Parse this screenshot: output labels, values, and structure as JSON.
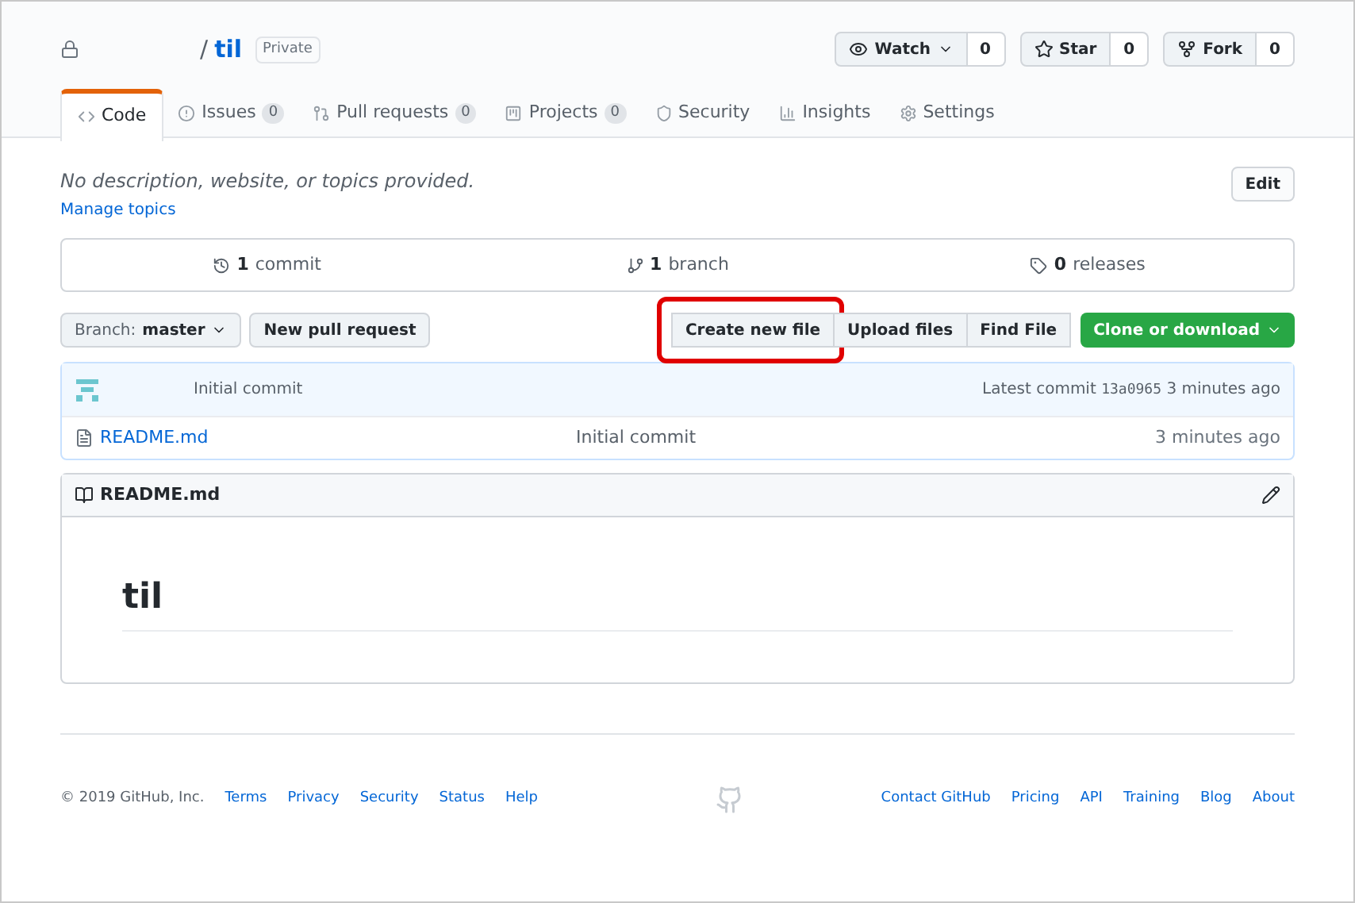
{
  "repo": {
    "name": "til",
    "visibility": "Private",
    "separator": "/"
  },
  "actions": [
    {
      "kind": "watch",
      "label": "Watch",
      "count": "0",
      "dropdown": true
    },
    {
      "kind": "star",
      "label": "Star",
      "count": "0",
      "dropdown": false
    },
    {
      "kind": "fork",
      "label": "Fork",
      "count": "0",
      "dropdown": false
    }
  ],
  "tabs": [
    {
      "kind": "code",
      "label": "Code",
      "selected": true
    },
    {
      "kind": "issues",
      "label": "Issues",
      "count": "0",
      "selected": false
    },
    {
      "kind": "pulls",
      "label": "Pull requests",
      "count": "0",
      "selected": false
    },
    {
      "kind": "projects",
      "label": "Projects",
      "count": "0",
      "selected": false
    },
    {
      "kind": "security",
      "label": "Security",
      "selected": false
    },
    {
      "kind": "insights",
      "label": "Insights",
      "selected": false
    },
    {
      "kind": "settings",
      "label": "Settings",
      "selected": false
    }
  ],
  "description": "No description, website, or topics provided.",
  "edit_button": "Edit",
  "manage_topics": "Manage topics",
  "summary": [
    {
      "kind": "commit",
      "count": "1",
      "label": "commit"
    },
    {
      "kind": "branch",
      "count": "1",
      "label": "branch"
    },
    {
      "kind": "release",
      "count": "0",
      "label": "releases"
    }
  ],
  "branch_button": {
    "label": "Branch:",
    "value": "master"
  },
  "new_pull_request": "New pull request",
  "file_buttons": [
    {
      "label": "Create new file",
      "highlighted": true
    },
    {
      "label": "Upload files",
      "highlighted": false
    },
    {
      "label": "Find File",
      "highlighted": false
    }
  ],
  "clone_button": "Clone or download",
  "latest_commit": {
    "message": "Initial commit",
    "label": "Latest commit",
    "sha": "13a0965",
    "time": "3 minutes ago"
  },
  "files": [
    {
      "name": "README.md",
      "message": "Initial commit",
      "time": "3 minutes ago"
    }
  ],
  "readme": {
    "title": "README.md",
    "heading": "til"
  },
  "footer": {
    "copyright": "© 2019 GitHub, Inc.",
    "left_links": [
      "Terms",
      "Privacy",
      "Security",
      "Status",
      "Help"
    ],
    "right_links": [
      "Contact GitHub",
      "Pricing",
      "API",
      "Training",
      "Blog",
      "About"
    ]
  }
}
